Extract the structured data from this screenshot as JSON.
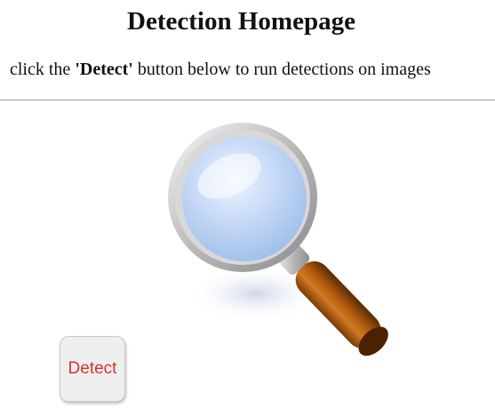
{
  "header": {
    "title": "Detection Homepage",
    "instruction_prefix": "click the ",
    "instruction_emphasis": "'Detect'",
    "instruction_suffix": " button below to run detections on images"
  },
  "illustration": {
    "icon": "magnifying-glass-icon"
  },
  "actions": {
    "detect_label": "Detect"
  },
  "colors": {
    "button_text": "#d6342a",
    "button_bg": "#efefef",
    "handle": "#b85f12",
    "lens": "#c7d8f5",
    "rim": "#c9c9c9"
  }
}
